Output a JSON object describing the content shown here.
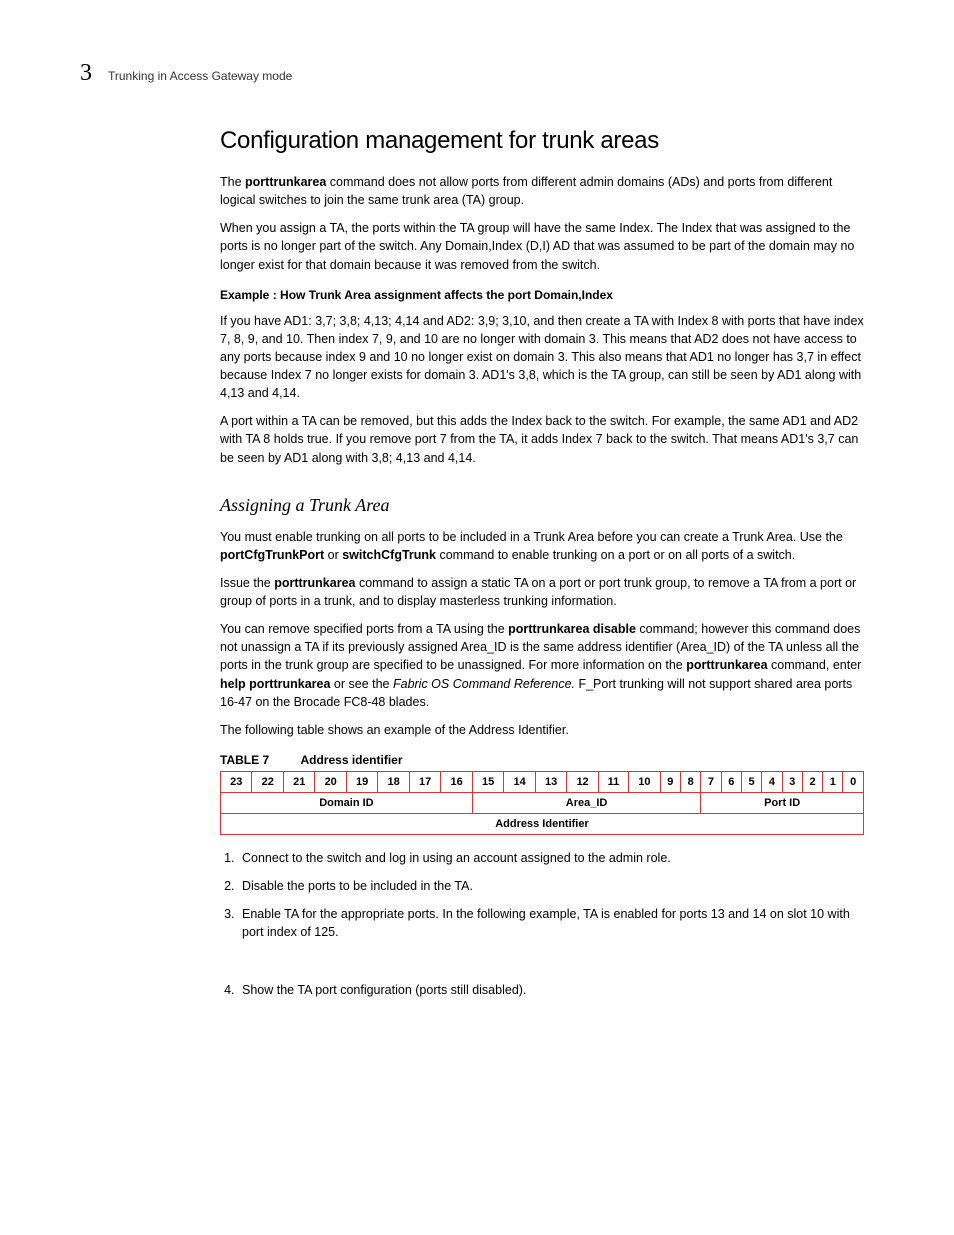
{
  "header": {
    "chapter_number": "3",
    "running_head": "Trunking in Access Gateway mode"
  },
  "section": {
    "title": "Configuration management for trunk areas",
    "p1a": "The ",
    "p1b": "porttrunkarea",
    "p1c": " command does not allow ports from different admin domains (ADs) and ports from different logical switches to join the same trunk area (TA) group.",
    "p2": "When you assign a TA, the ports within the TA group will have the same Index. The Index that was assigned to the ports is no longer part of the switch. Any Domain,Index (D,I) AD that was assumed to be part of the domain may no longer exist for that domain because it was removed from the switch.",
    "example_title": "Example : How Trunk Area assignment affects the port Domain,Index",
    "p3": "If you have AD1: 3,7; 3,8; 4,13; 4,14 and AD2: 3,9; 3,10, and then create a TA with Index 8 with ports that have index 7, 8, 9, and 10. Then index 7, 9, and 10 are no longer with domain 3. This means that AD2 does not have access to any ports because index 9 and 10 no longer exist on domain 3. This also means that AD1 no longer has 3,7 in effect because Index 7 no longer exists for domain 3. AD1's 3,8, which is the TA group, can still be seen by AD1 along with 4,13 and 4,14.",
    "p4": "A port within a TA can be removed, but this adds the Index back to the switch. For example, the same AD1 and AD2 with TA 8 holds true. If you remove port 7 from the TA, it adds Index 7 back to the switch. That means AD1's 3,7 can be seen by AD1 along with 3,8; 4,13 and 4,14."
  },
  "subsection": {
    "title": "Assigning a Trunk Area",
    "p1a": "You must enable trunking on all ports to be included in a Trunk Area before you can create a Trunk Area. Use the ",
    "p1b": "portCfgTrunkPort",
    "p1c": " or ",
    "p1d": "switchCfgTrunk",
    "p1e": " command to enable trunking on a port or on all ports of a switch.",
    "p2a": "Issue the ",
    "p2b": "porttrunkarea",
    "p2c": " command to assign a static TA on a port or port trunk group, to remove a TA from a port or group of ports in a trunk, and to display masterless trunking information.",
    "p3a": "You can remove specified ports from a TA using the ",
    "p3b": "porttrunkarea    disable",
    "p3c": " command; however this command does not unassign a TA if its previously assigned Area_ID is the same address identifier (Area_ID) of the TA unless all the ports in the trunk group are specified to be unassigned. For more information on the ",
    "p3d": "porttrunkarea",
    "p3e": " command, enter ",
    "p3f": "help porttrunkarea",
    "p3g": " or see the ",
    "p3h": "Fabric OS Command Reference.",
    "p3i": " F_Port trunking will not support shared area ports 16-47 on the Brocade FC8-48 blades.",
    "p4": "The following table shows an example of the Address Identifier."
  },
  "table": {
    "label": "TABLE 7",
    "title": "Address identifier",
    "bits": [
      "23",
      "22",
      "21",
      "20",
      "19",
      "18",
      "17",
      "16",
      "15",
      "14",
      "13",
      "12",
      "11",
      "10",
      "9",
      "8",
      "7",
      "6",
      "5",
      "4",
      "3",
      "2",
      "1",
      "0"
    ],
    "row2": {
      "domain": "Domain ID",
      "area": "Area_ID",
      "port": "Port ID"
    },
    "row3": "Address Identifier"
  },
  "steps": {
    "s1": "Connect to the switch and log in using an account assigned to the admin role.",
    "s2": "Disable the ports to be included in the TA.",
    "s3": "Enable TA for the appropriate ports. In the following example, TA is enabled for ports 13 and 14 on slot 10 with port index of 125.",
    "s4": "Show the TA port configuration (ports still disabled)."
  }
}
